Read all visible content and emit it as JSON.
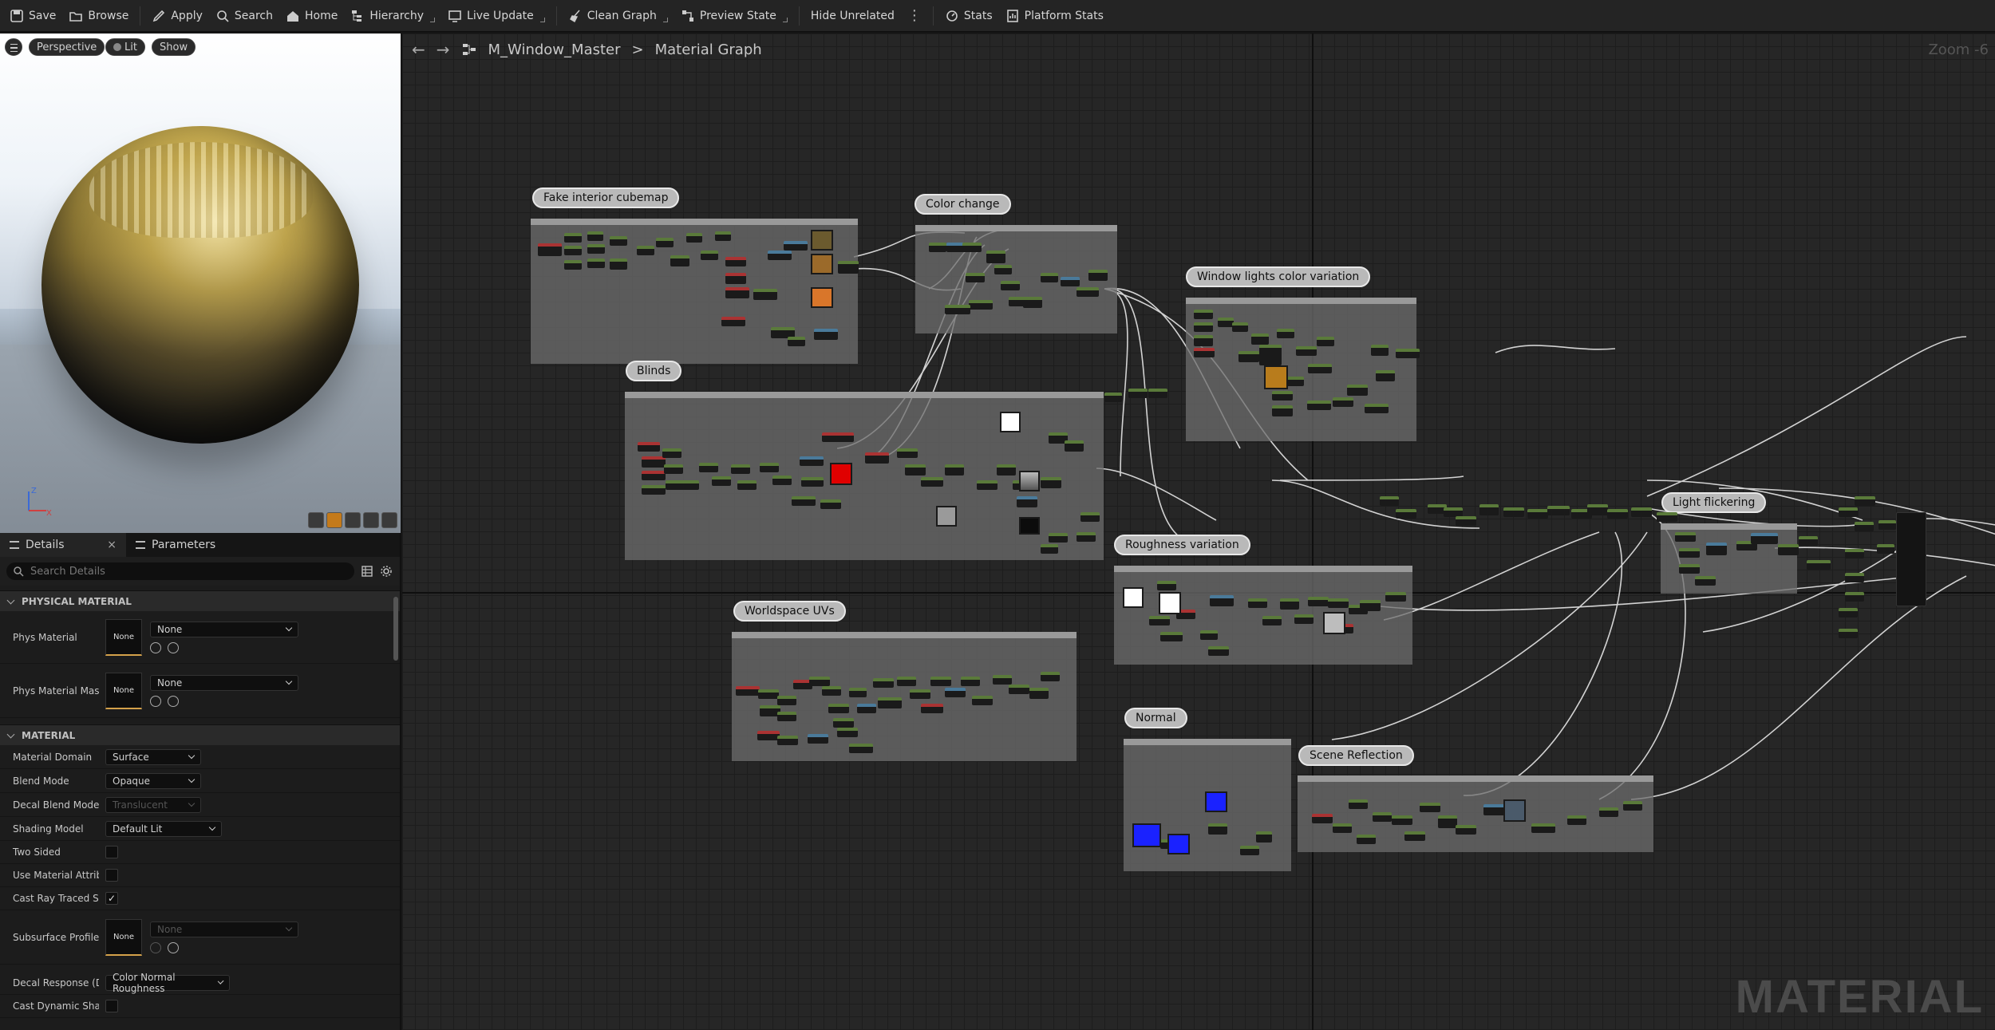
{
  "toolbar": {
    "save": "Save",
    "browse": "Browse",
    "apply": "Apply",
    "search": "Search",
    "home": "Home",
    "hierarchy": "Hierarchy",
    "live_update": "Live Update",
    "clean_graph": "Clean Graph",
    "preview_state": "Preview State",
    "hide_unrelated": "Hide Unrelated",
    "more": "⋮",
    "stats": "Stats",
    "platform_stats": "Platform Stats"
  },
  "viewport": {
    "perspective": "Perspective",
    "lit": "Lit",
    "show": "Show",
    "axis_z": "Z",
    "axis_x": "X"
  },
  "panel": {
    "tab_details": "Details",
    "tab_parameters": "Parameters",
    "close": "×",
    "search_placeholder": "Search Details",
    "section_physical": "PHYSICAL MATERIAL",
    "phys_material": "Phys Material",
    "phys_material_value": "None",
    "phys_material_thumb": "None",
    "phys_material_mask": "Phys Material Mask",
    "phys_material_mask_value": "None",
    "phys_material_mask_thumb": "None",
    "section_material": "MATERIAL",
    "material_domain": "Material Domain",
    "material_domain_value": "Surface",
    "blend_mode": "Blend Mode",
    "blend_mode_value": "Opaque",
    "decal_blend_mode": "Decal Blend Mode",
    "decal_blend_mode_value": "Translucent",
    "shading_model": "Shading Model",
    "shading_model_value": "Default Lit",
    "two_sided": "Two Sided",
    "use_material_attributes": "Use Material Attribut",
    "cast_ray_traced": "Cast Ray Traced Sha",
    "cast_ray_traced_check": "✓",
    "subsurface_profile": "Subsurface Profile",
    "subsurface_thumb": "None",
    "subsurface_value": "None",
    "decal_response": "Decal Response (DBu",
    "decal_response_value": "Color Normal Roughness",
    "cast_dynamic_shadow": "Cast Dynamic Shado"
  },
  "graph": {
    "breadcrumb_asset": "M_Window_Master",
    "breadcrumb_sep": ">",
    "breadcrumb_graph": "Material Graph",
    "zoom": "Zoom -6",
    "watermark": "MATERIAL",
    "comments": {
      "fake_interior": "Fake interior cubemap",
      "color_change": "Color change",
      "window_lights": "Window lights color variation",
      "blinds": "Blinds",
      "light_flickering": "Light flickering",
      "roughness": "Roughness variation",
      "worldspace": "Worldspace UVs",
      "normal": "Normal",
      "scene_reflection": "Scene Reflection"
    }
  },
  "colors": {
    "accent": "#d4a14a",
    "graph_bg": "#262626",
    "comment_body": "#6e6e6e"
  }
}
